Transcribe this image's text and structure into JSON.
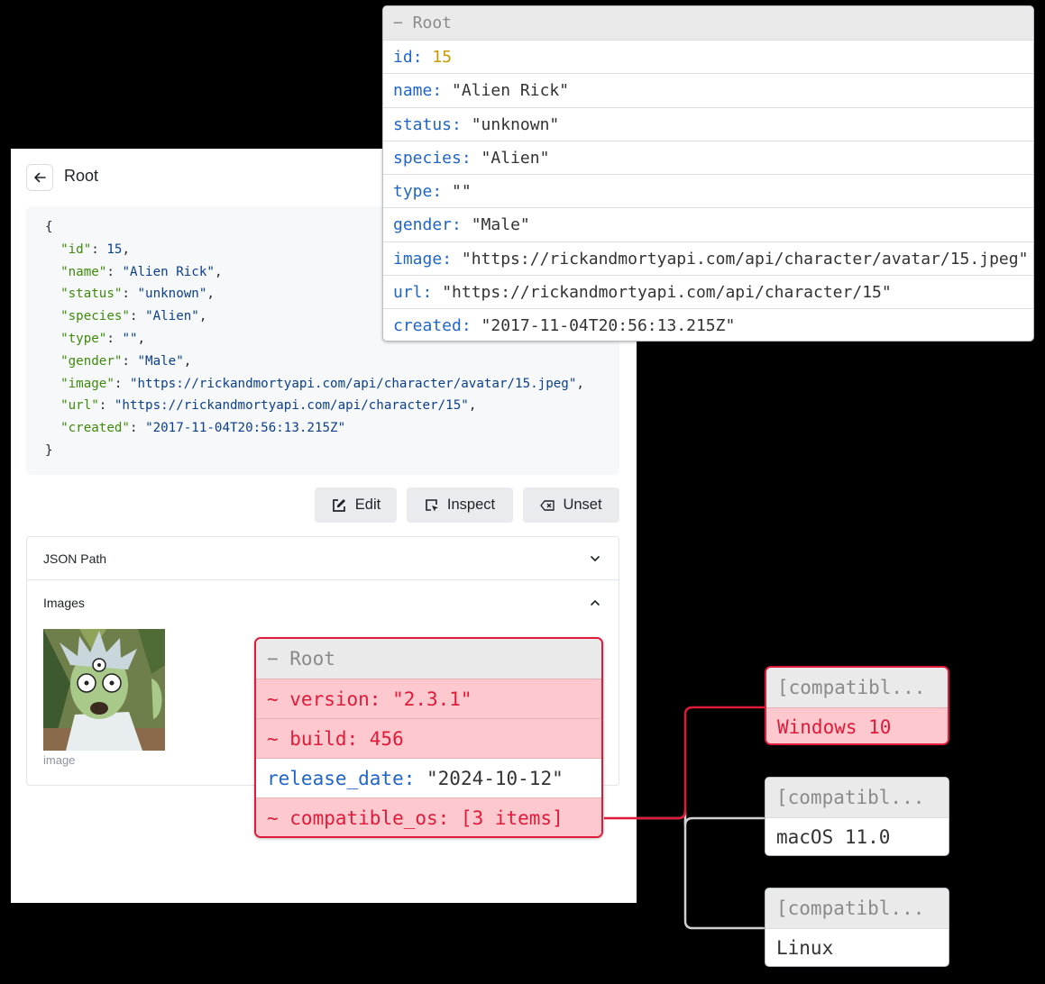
{
  "panel": {
    "title": "Root",
    "json_lines": [
      [
        {
          "t": "p",
          "v": "{"
        }
      ],
      [
        {
          "t": "k",
          "v": "  \"id\""
        },
        {
          "t": "p",
          "v": ": "
        },
        {
          "t": "n",
          "v": "15"
        },
        {
          "t": "p",
          "v": ","
        }
      ],
      [
        {
          "t": "k",
          "v": "  \"name\""
        },
        {
          "t": "p",
          "v": ": "
        },
        {
          "t": "s",
          "v": "\"Alien Rick\""
        },
        {
          "t": "p",
          "v": ","
        }
      ],
      [
        {
          "t": "k",
          "v": "  \"status\""
        },
        {
          "t": "p",
          "v": ": "
        },
        {
          "t": "s",
          "v": "\"unknown\""
        },
        {
          "t": "p",
          "v": ","
        }
      ],
      [
        {
          "t": "k",
          "v": "  \"species\""
        },
        {
          "t": "p",
          "v": ": "
        },
        {
          "t": "s",
          "v": "\"Alien\""
        },
        {
          "t": "p",
          "v": ","
        }
      ],
      [
        {
          "t": "k",
          "v": "  \"type\""
        },
        {
          "t": "p",
          "v": ": "
        },
        {
          "t": "s",
          "v": "\"\""
        },
        {
          "t": "p",
          "v": ","
        }
      ],
      [
        {
          "t": "k",
          "v": "  \"gender\""
        },
        {
          "t": "p",
          "v": ": "
        },
        {
          "t": "s",
          "v": "\"Male\""
        },
        {
          "t": "p",
          "v": ","
        }
      ],
      [
        {
          "t": "k",
          "v": "  \"image\""
        },
        {
          "t": "p",
          "v": ": "
        },
        {
          "t": "s",
          "v": "\"https://rickandmortyapi.com/api/character/avatar/15.jpeg\""
        },
        {
          "t": "p",
          "v": ","
        }
      ],
      [
        {
          "t": "k",
          "v": "  \"url\""
        },
        {
          "t": "p",
          "v": ": "
        },
        {
          "t": "s",
          "v": "\"https://rickandmortyapi.com/api/character/15\""
        },
        {
          "t": "p",
          "v": ","
        }
      ],
      [
        {
          "t": "k",
          "v": "  \"created\""
        },
        {
          "t": "p",
          "v": ": "
        },
        {
          "t": "s",
          "v": "\"2017-11-04T20:56:13.215Z\""
        }
      ],
      [
        {
          "t": "p",
          "v": "}"
        }
      ]
    ],
    "buttons": {
      "edit": "Edit",
      "inspect": "Inspect",
      "unset": "Unset"
    },
    "accordion": {
      "json_path": "JSON Path",
      "images": "Images",
      "image_caption": "image"
    }
  },
  "inspector_root": {
    "header": "− Root",
    "rows": [
      {
        "key": "id",
        "value": "15",
        "kind": "number"
      },
      {
        "key": "name",
        "value": "\"Alien Rick\"",
        "kind": "string"
      },
      {
        "key": "status",
        "value": "\"unknown\"",
        "kind": "string"
      },
      {
        "key": "species",
        "value": "\"Alien\"",
        "kind": "string"
      },
      {
        "key": "type",
        "value": "\"\"",
        "kind": "string"
      },
      {
        "key": "gender",
        "value": "\"Male\"",
        "kind": "string"
      },
      {
        "key": "image",
        "value": "\"https://rickandmortyapi.com/api/character/avatar/15.jpeg\"",
        "kind": "string"
      },
      {
        "key": "url",
        "value": "\"https://rickandmortyapi.com/api/character/15\"",
        "kind": "string"
      },
      {
        "key": "created",
        "value": "\"2017-11-04T20:56:13.215Z\"",
        "kind": "string"
      }
    ]
  },
  "diff_root": {
    "header": "− Root",
    "rows": [
      {
        "text": "~ version: \"2.3.1\"",
        "changed": true
      },
      {
        "text": "~ build: 456",
        "changed": true
      },
      {
        "key": "release_date",
        "value": "\"2024-10-12\"",
        "changed": false
      },
      {
        "text": "~ compatible_os: [3 items]",
        "changed": true
      }
    ]
  },
  "compat_windows": [
    {
      "header": "[compatibl...",
      "value": "Windows 10",
      "changed": true
    },
    {
      "header": "[compatibl...",
      "value": "macOS 11.0",
      "changed": false
    },
    {
      "header": "[compatibl...",
      "value": "Linux",
      "changed": false
    }
  ],
  "colors": {
    "accent_red": "#e01b3a",
    "diff_bg": "#fdc9cf",
    "key_blue": "#1f66c7",
    "number_gold": "#c89a00"
  }
}
